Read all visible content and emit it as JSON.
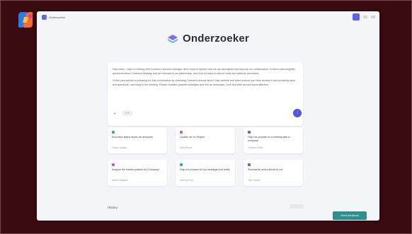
{
  "window": {
    "app_title": "Onderzoeker"
  },
  "brand": {
    "name": "Onderzoeker"
  },
  "prompt": {
    "paragraph_1": "Next week, I have a meeting with Contoso's account manager, and I want to explore how we can strengthen and improve our collaboration. I'd like to ask insightful questions about Contoso's strategy that are relevant to our partnership, and look for ways to reduce costs and optimize processes.",
    "paragraph_2": "I'd like your advice in preparing for this conversation by reviewing Contoso's annual report, their website and other sources you have access to and providing input and questions I can bring to the meeting. Please consider possible strategies and risk as necessary. You'll find their annual report attached.",
    "plus_glyph": "+",
    "chip_label": "2 ✎",
    "send_glyph": "↑"
  },
  "cards": [
    {
      "title": "Executive status report via @reports",
      "sub": "Project Update",
      "color": "#3aa7b0"
    },
    {
      "title": "Update me on Project",
      "sub": "Daily Report",
      "color": "#c061c9"
    },
    {
      "title": "Help me prepare for a meeting with a company",
      "sub": "Customer Brief",
      "color": "#5a6be6"
    },
    {
      "title": "Analyze the market position of (Company)",
      "sub": "Market Analysis",
      "color": "#c061c9"
    },
    {
      "title": "Help me prepare for my meetings next week",
      "sub": "Meeting Prep",
      "color": "#3aa7b0"
    },
    {
      "title": "Summarize action items for me",
      "sub": "Task Tracker",
      "color": "#5a6be6"
    }
  ],
  "history": {
    "label": "History"
  },
  "footer": {
    "teal_button": "Send feedback"
  }
}
